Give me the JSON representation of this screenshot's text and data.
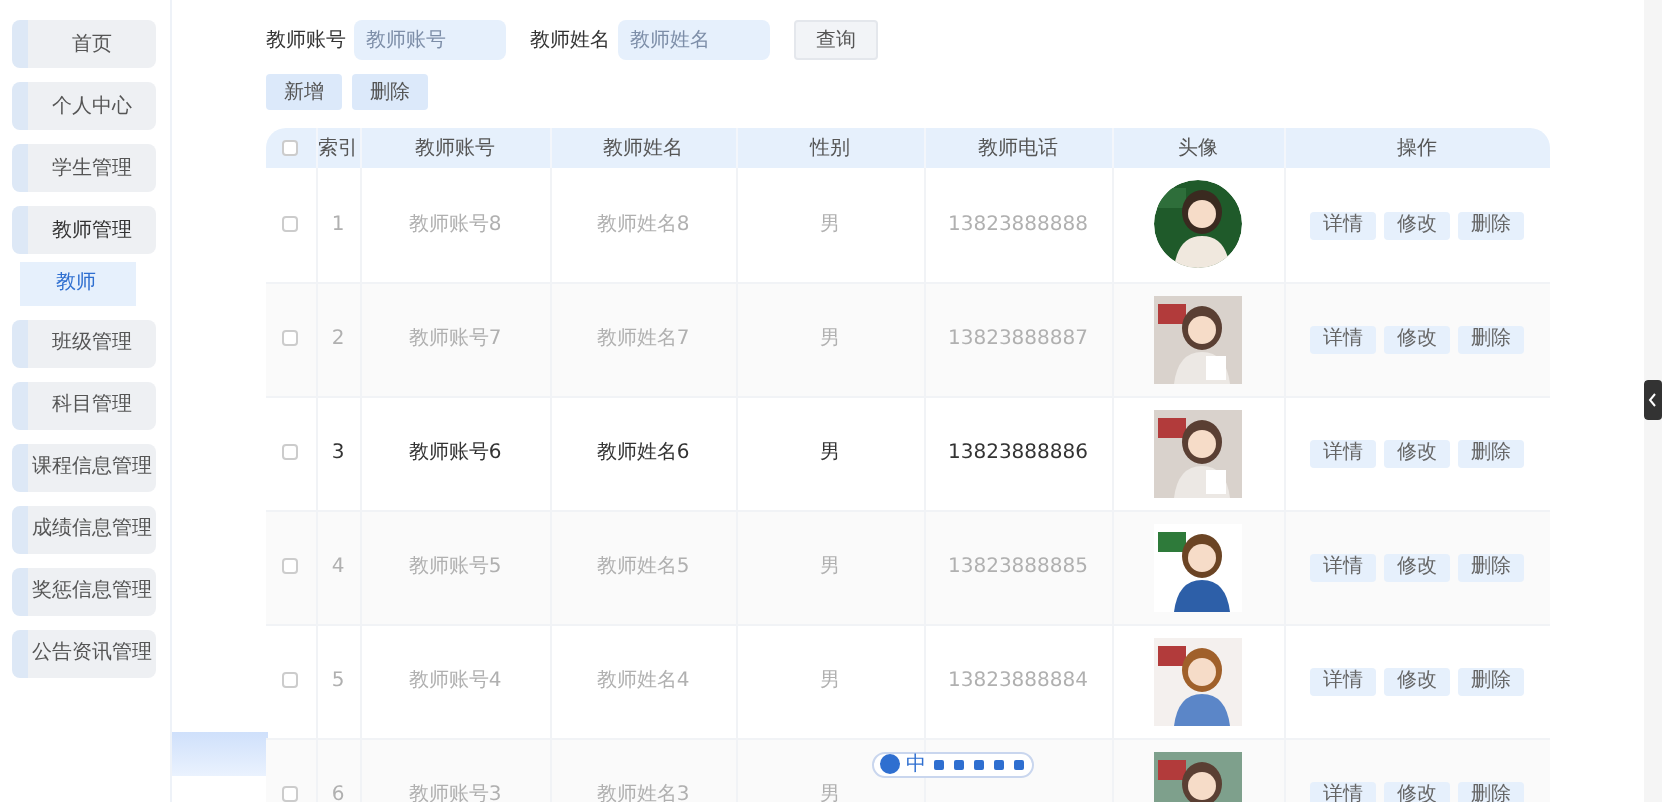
{
  "sidebar": {
    "items": [
      {
        "label": "首页",
        "expanded": false
      },
      {
        "label": "个人中心",
        "expanded": false
      },
      {
        "label": "学生管理",
        "expanded": false
      },
      {
        "label": "教师管理",
        "expanded": true,
        "children": [
          {
            "label": "教师",
            "selected": true
          }
        ]
      },
      {
        "label": "班级管理",
        "expanded": false
      },
      {
        "label": "科目管理",
        "expanded": false
      },
      {
        "label": "课程信息管理",
        "expanded": false
      },
      {
        "label": "成绩信息管理",
        "expanded": false
      },
      {
        "label": "奖惩信息管理",
        "expanded": false
      },
      {
        "label": "公告资讯管理",
        "expanded": false
      }
    ]
  },
  "search": {
    "fields": [
      {
        "label": "教师账号",
        "placeholder": "教师账号"
      },
      {
        "label": "教师姓名",
        "placeholder": "教师姓名"
      }
    ],
    "button": "查询"
  },
  "actions": [
    "新增",
    "删除"
  ],
  "table": {
    "header_checked": false,
    "columns": [
      "索引",
      "教师账号",
      "教师姓名",
      "性别",
      "教师电话",
      "头像",
      "操作"
    ],
    "rows": [
      {
        "checked": false,
        "hovered": false,
        "index": "1",
        "account": "教师账号8",
        "name": "教师姓名8",
        "gender": "男",
        "phone": "13823888888",
        "actions": [
          "详情",
          "修改",
          "删除"
        ]
      },
      {
        "checked": false,
        "hovered": false,
        "index": "2",
        "account": "教师账号7",
        "name": "教师姓名7",
        "gender": "男",
        "phone": "13823888887",
        "actions": [
          "详情",
          "修改",
          "删除"
        ]
      },
      {
        "checked": false,
        "hovered": true,
        "index": "3",
        "account": "教师账号6",
        "name": "教师姓名6",
        "gender": "男",
        "phone": "13823888886",
        "actions": [
          "详情",
          "修改",
          "删除"
        ]
      },
      {
        "checked": false,
        "hovered": false,
        "index": "4",
        "account": "教师账号5",
        "name": "教师姓名5",
        "gender": "男",
        "phone": "13823888885",
        "actions": [
          "详情",
          "修改",
          "删除"
        ]
      },
      {
        "checked": false,
        "hovered": false,
        "index": "5",
        "account": "教师账号4",
        "name": "教师姓名4",
        "gender": "男",
        "phone": "13823888884",
        "actions": [
          "详情",
          "修改",
          "删除"
        ]
      },
      {
        "checked": false,
        "hovered": false,
        "index": "6",
        "account": "教师账号3",
        "name": "教师姓名3",
        "gender": "男",
        "actions": [
          "详情",
          "修改",
          "删除"
        ]
      }
    ]
  },
  "ime_toolbar": {
    "label": "中"
  }
}
